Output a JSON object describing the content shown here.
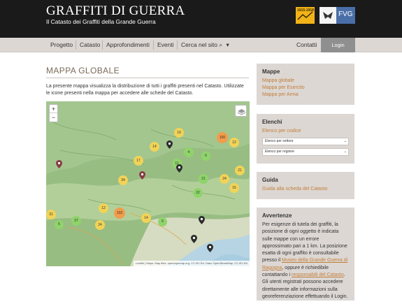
{
  "header": {
    "title": "GRAFFITI DI GUERRA",
    "subtitle": "Il Catasto dei Graffiti della Grande Guerra",
    "logo_years": "1915-1918",
    "logo_fvg": "FVG"
  },
  "nav": {
    "items": [
      "Progetto",
      "Catasto",
      "Approfondimenti",
      "Eventi"
    ],
    "search_label": "Cerca nel sito",
    "contacts": "Contatti",
    "login": "Login"
  },
  "main": {
    "title": "MAPPA GLOBALE",
    "intro": "La presente mappa visualizza la distribuzione di tutti i graffiti presenti nel Catasto. Utilizzate le icone presenti nella mappa per accedere alle schede del Catasto.",
    "zoom_in": "+",
    "zoom_out": "−",
    "attribution": "Leaflet | Maps: Map tiles: opentopomap.org, CC-BY-SA. Data: OpenStreetMap, CC-BY-SA",
    "clusters": [
      "19",
      "14",
      "17",
      "11",
      "4",
      "100",
      "12",
      "6",
      "34",
      "21",
      "21",
      "24",
      "15",
      "22",
      "31",
      "37",
      "12",
      "103",
      "14",
      "6",
      "5",
      "24"
    ]
  },
  "sidebar": {
    "mappe": {
      "title": "Mappe",
      "links": [
        "Mappa globale",
        "Mappa per Esercito",
        "Mappa per Arma"
      ]
    },
    "elenchi": {
      "title": "Elenchi",
      "link": "Elenco per codice",
      "select1": "Elenco per settore",
      "select2": "Elenco per regione"
    },
    "guida": {
      "title": "Guida",
      "link": "Guida alla scheda del Catasto"
    },
    "avvertenze": {
      "title": "Avvertenze",
      "text1": "Per esigenze di tutela dei graffiti, la posizione di ogni oggetto è indicata sulle mappe con un errore approssimato pari a 1 km. La posizione esatta di ogni graffito è consultabile presso il ",
      "link1": "Museo della Grande Guerra di Ragogna",
      "text2": ", oppure è richiedibile contattando i ",
      "link2": "responsabili del Catasto",
      "text3": ". Gli utenti registrati possono accedere direttamente alle informazioni sulla georeferenziazione effettuando il Login."
    }
  },
  "colors": {
    "header_bg": "#1a1a1a",
    "nav_bg": "#dcd7d3",
    "accent_link": "#c27e3a",
    "title_brown": "#7a6a58",
    "cluster_green": "#8fd46b",
    "cluster_yellow": "#f1d357",
    "cluster_orange": "#f29c4a"
  }
}
